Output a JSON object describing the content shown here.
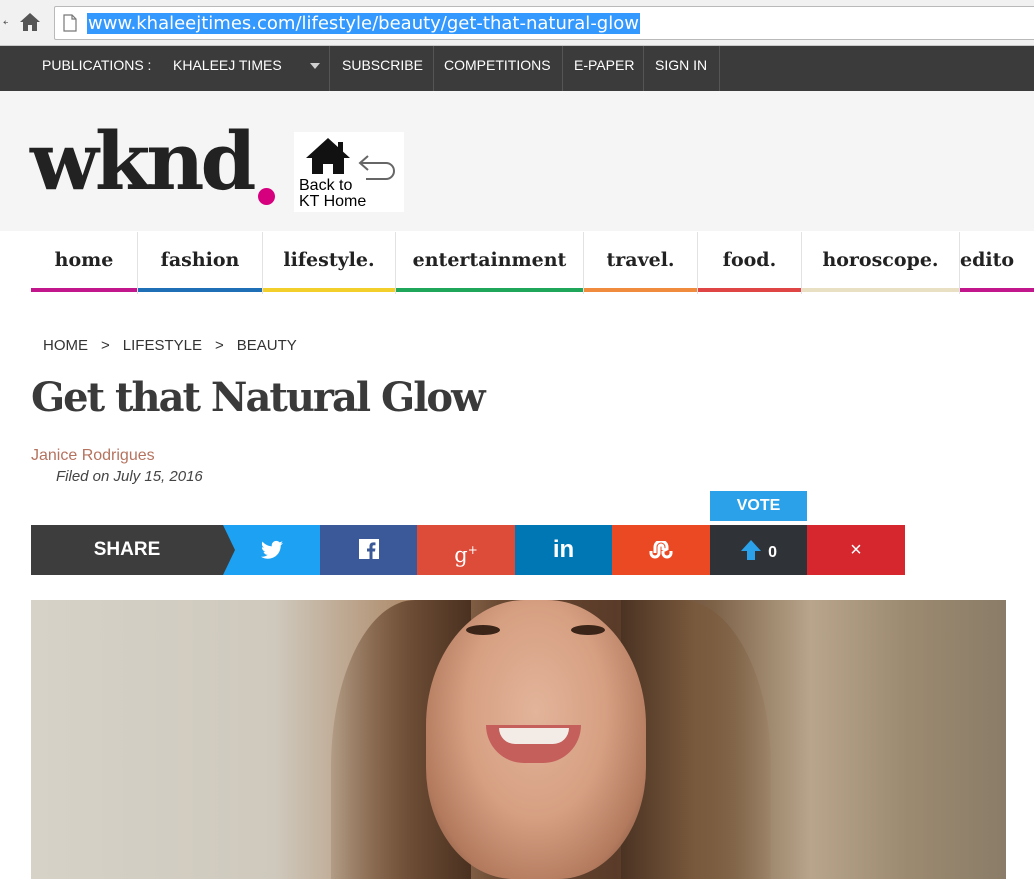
{
  "browser": {
    "url": "www.khaleejtimes.com/lifestyle/beauty/get-that-natural-glow"
  },
  "topbar": {
    "publications_label": "PUBLICATIONS :",
    "khaleej_times": "KHALEEJ TIMES",
    "subscribe": "SUBSCRIBE",
    "competitions": "COMPETITIONS",
    "epaper": "E-PAPER",
    "signin": "SIGN IN"
  },
  "logo": {
    "text": "wknd",
    "dot_color": "#d6007f",
    "back_home_line1": "Back to",
    "back_home_line2": "KT Home"
  },
  "nav": {
    "items": [
      {
        "label": "home",
        "color": "#c2168c"
      },
      {
        "label": "fashion",
        "color": "#1e6fb5"
      },
      {
        "label": "lifestyle.",
        "color": "#f2cf2b"
      },
      {
        "label": "entertainment",
        "color": "#1fa65a"
      },
      {
        "label": "travel.",
        "color": "#f08a3c"
      },
      {
        "label": "food.",
        "color": "#e04545"
      },
      {
        "label": "horoscope.",
        "color": "#e9dfc2"
      },
      {
        "label": "edito",
        "color": "#c2168c"
      }
    ]
  },
  "breadcrumb": {
    "home": "HOME",
    "sep": ">",
    "lifestyle": "LIFESTYLE",
    "beauty": "BEAUTY"
  },
  "article": {
    "title": "Get that Natural Glow",
    "author": "Janice Rodrigues",
    "filed": "Filed on July 15, 2016"
  },
  "share": {
    "label": "SHARE",
    "vote_label": "VOTE",
    "vote_count": "0",
    "colors": {
      "twitter": "#1da1f2",
      "facebook": "#3b5998",
      "googleplus": "#dd4b39",
      "linkedin": "#0077b5",
      "stumbleupon": "#eb4924",
      "vote": "#2f3237",
      "close": "#d6262e"
    }
  }
}
